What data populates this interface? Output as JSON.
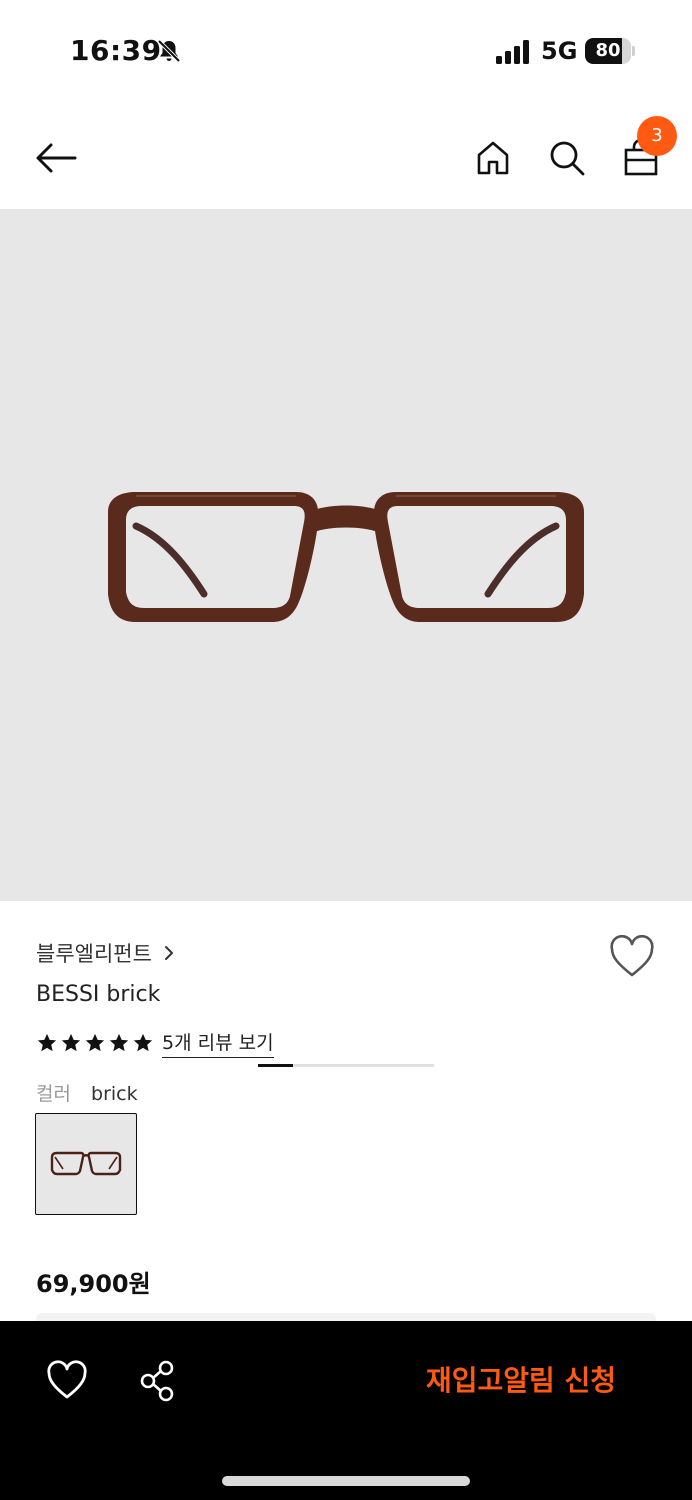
{
  "status_bar": {
    "time": "16:39",
    "network": "5G",
    "battery_level": "80",
    "battery_fraction": 0.8,
    "icons": [
      "bell-slash-icon",
      "signal-icon",
      "battery-icon"
    ]
  },
  "nav": {
    "cart_count": "3",
    "icons": [
      "arrow-left-icon",
      "home-icon",
      "search-icon",
      "shopping-bag-icon"
    ],
    "accent_color": "#ff5a12"
  },
  "gallery": {
    "image_name": "brown-rectangular-eyeglasses",
    "current_index": 1,
    "total_images": 5
  },
  "product": {
    "brand": "블루엘리펀트",
    "name": "BESSI brick",
    "rating": 5,
    "rating_max": 5,
    "review_link": "5개 리뷰 보기",
    "color_label": "컬러",
    "color_value": "brick",
    "price": "69,900원"
  },
  "bottom_bar": {
    "restock_label": "재입고알림 신청",
    "icons": [
      "heart-icon",
      "share-icon"
    ]
  },
  "colors": {
    "accent": "#ff5a12",
    "image_bg": "#e8e7e7",
    "bottom_bar_bg": "#000000"
  }
}
